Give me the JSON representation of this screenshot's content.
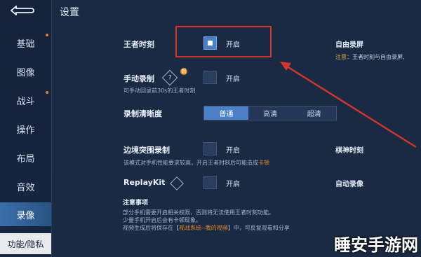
{
  "sidebar": {
    "back_symbol": "⮌",
    "items": [
      {
        "label": "基础",
        "active": false
      },
      {
        "label": "图像",
        "active": false
      },
      {
        "label": "战斗",
        "active": false
      },
      {
        "label": "操作",
        "active": false
      },
      {
        "label": "布局",
        "active": false
      },
      {
        "label": "音效",
        "active": false
      },
      {
        "label": "录像",
        "active": true
      }
    ],
    "bottom_label": "功能/隐私"
  },
  "header": {
    "title": "设置"
  },
  "settings": {
    "king_moment": {
      "label": "王者时刻",
      "option": "开启",
      "checked": true
    },
    "manual_record": {
      "label": "手动录制",
      "help": "?",
      "badge": "新",
      "option": "开启",
      "checked": false,
      "sub": "可手动回录前30s的王者时刻"
    },
    "clarity": {
      "label": "录制清晰度",
      "options": [
        "普通",
        "高清",
        "超清"
      ],
      "selected": "普通"
    },
    "edge_breakout": {
      "label": "边境突围录制",
      "option": "开启",
      "checked": false,
      "sub_prefix": "该模式对手机性能要求较高，开启王者时刻后可能造成",
      "sub_link": "卡顿"
    },
    "replaykit": {
      "label": "ReplayKit",
      "option": "开启",
      "checked": false
    }
  },
  "right_col": {
    "auto_record_screen": "自由录屏",
    "warn_prefix": "注意：",
    "warn_text": "王者时刻与自由录屏,",
    "chess_moment": "棋神时刻",
    "auto_record": "自动录像"
  },
  "notes": {
    "title": "注意事项",
    "line1": "部分手机需要开启相关权限，否则将无法使用王者时刻功能。",
    "line2": "少量手机开启后会有卡顿现象。",
    "line3_prefix": "视频生成后将保存在【",
    "line3_link": "视战系统--我的视频",
    "line3_suffix": "】中，可反复观看和分享"
  },
  "watermark": "睡安手游网",
  "colors": {
    "accent": "#4b7fc6",
    "highlight": "#d2342e",
    "bg": "#1b2a43",
    "warn": "#d9b33a"
  }
}
